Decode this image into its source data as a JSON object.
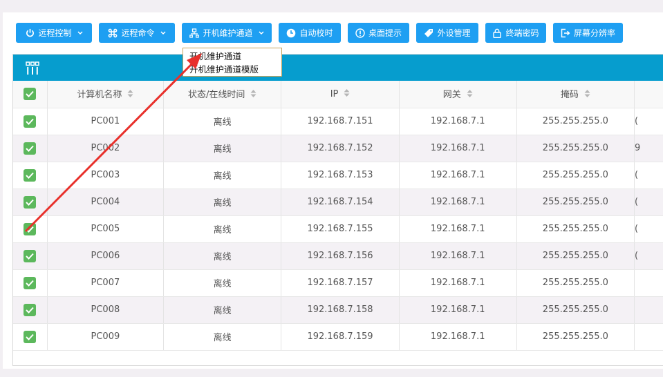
{
  "toolbar": {
    "remote_control": "远程控制",
    "remote_command": "远程命令",
    "boot_channel": "开机维护通道",
    "auto_time": "自动校时",
    "desktop_hint": "桌面提示",
    "peripheral": "外设管理",
    "lock_password": "终端密码",
    "resolution": "屏幕分辨率"
  },
  "dropdown": {
    "item1": "开机维护通道",
    "item2": "开机维护通道模版"
  },
  "table": {
    "headers": {
      "name": "计算机名称",
      "status": "状态/在线时间",
      "ip": "IP",
      "gateway": "网关",
      "mask": "掩码"
    },
    "rows": [
      {
        "name": "PC001",
        "status": "离线",
        "ip": "192.168.7.151",
        "gateway": "192.168.7.1",
        "mask": "255.255.255.0",
        "extra": "("
      },
      {
        "name": "PC002",
        "status": "离线",
        "ip": "192.168.7.152",
        "gateway": "192.168.7.1",
        "mask": "255.255.255.0",
        "extra": "9"
      },
      {
        "name": "PC003",
        "status": "离线",
        "ip": "192.168.7.153",
        "gateway": "192.168.7.1",
        "mask": "255.255.255.0",
        "extra": "("
      },
      {
        "name": "PC004",
        "status": "离线",
        "ip": "192.168.7.154",
        "gateway": "192.168.7.1",
        "mask": "255.255.255.0",
        "extra": "("
      },
      {
        "name": "PC005",
        "status": "离线",
        "ip": "192.168.7.155",
        "gateway": "192.168.7.1",
        "mask": "255.255.255.0",
        "extra": "("
      },
      {
        "name": "PC006",
        "status": "离线",
        "ip": "192.168.7.156",
        "gateway": "192.168.7.1",
        "mask": "255.255.255.0",
        "extra": "("
      },
      {
        "name": "PC007",
        "status": "离线",
        "ip": "192.168.7.157",
        "gateway": "192.168.7.1",
        "mask": "255.255.255.0",
        "extra": ""
      },
      {
        "name": "PC008",
        "status": "离线",
        "ip": "192.168.7.158",
        "gateway": "192.168.7.1",
        "mask": "255.255.255.0",
        "extra": ""
      },
      {
        "name": "PC009",
        "status": "离线",
        "ip": "192.168.7.159",
        "gateway": "192.168.7.1",
        "mask": "255.255.255.0",
        "extra": ""
      }
    ]
  },
  "colors": {
    "button": "#1e9ff2",
    "table_header_bar": "#069dce",
    "checkbox": "#5cb85c",
    "annotation_arrow": "#e8302b"
  }
}
